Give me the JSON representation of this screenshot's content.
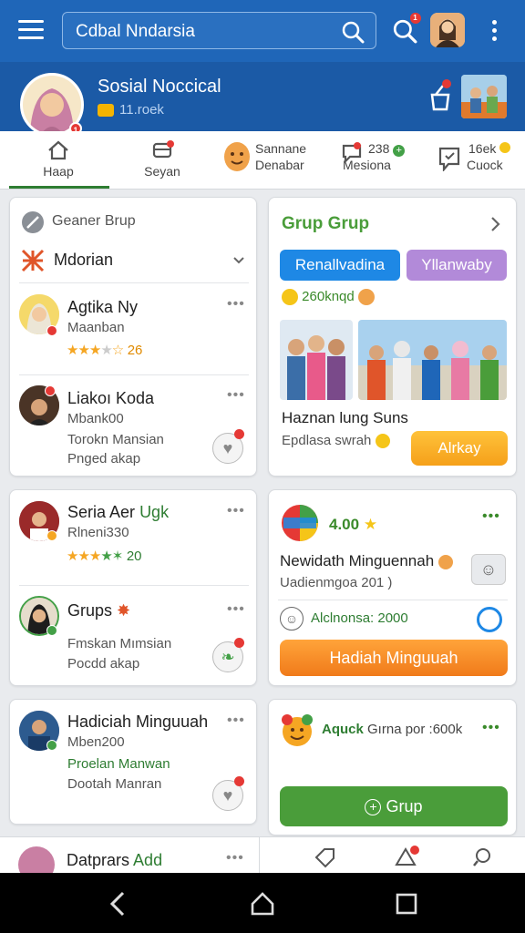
{
  "topbar": {
    "search_text": "Cdbal Nndarsia",
    "notif_count": "1",
    "avatar_badge": "1"
  },
  "profile": {
    "name": "Sosial Noccical",
    "sub": "11.roek",
    "icon_badge": "1"
  },
  "tabs": [
    {
      "label1": "Haap",
      "label2": ""
    },
    {
      "label1": "Seyan",
      "label2": ""
    },
    {
      "label1": "Sannane",
      "label2": "Denabar"
    },
    {
      "label1": "238",
      "label2": "Mesiona"
    },
    {
      "label1": "16ek",
      "label2": "Cuock"
    }
  ],
  "left_card1": {
    "header": "Geaner Brup",
    "dropdown": "Mdorian",
    "items": [
      {
        "name": "Agtika Ny",
        "sub": "Maanban",
        "rating": "26"
      },
      {
        "name": "Liakoı Koda",
        "sub": "Mbank00",
        "line1": "Torokn Mansian",
        "line2": "Pnged akap"
      }
    ]
  },
  "left_card2": {
    "items": [
      {
        "name": "Seria Aer",
        "tag": "Ugk",
        "sub": "Rlneni330",
        "rating": "20"
      },
      {
        "name": "Grups",
        "line1": "Fmskan Mımsian",
        "line2": "Pocdd akap"
      }
    ]
  },
  "left_card3": {
    "name": "Hadiciah Minguuah",
    "sub": "Mben200",
    "line1": "Proelan Manwan",
    "line2": "Dootah Manran"
  },
  "left_card4": {
    "name": "Datprars",
    "tag": "Add"
  },
  "right_card1": {
    "title": "Grup Grup",
    "pill1": "Renallvadina",
    "pill2": "Yllanwaby",
    "count": "260knqd",
    "caption": "Haznan lung Suns",
    "sub": "Epdlasa swrah",
    "button": "Alrkay"
  },
  "right_card2": {
    "rating": "4.00",
    "title": "Newidath Minguennah",
    "sub": "Uadienmgoa 201 )",
    "stat": "Alclnonsa: 2000",
    "button": "Hadiah Minguuah"
  },
  "right_card3": {
    "label1": "Aquck",
    "label2": "Gırna por :600k",
    "button": "Grup"
  },
  "colors": {
    "topbar": "#1f66b8",
    "accent_green": "#2e7d32",
    "orange": "#f5901e",
    "pill_blue": "#1e88e5",
    "pill_purple": "#b28ad9"
  }
}
